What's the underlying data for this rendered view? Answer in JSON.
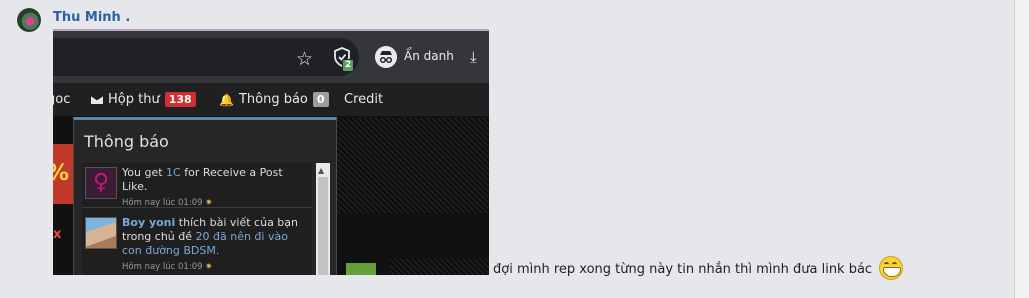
{
  "post": {
    "author": "Thu Minh .",
    "message": "đợi mình rep xong từng này tin nhắn thì mình đưa link bác"
  },
  "screenshot": {
    "browser": {
      "incognito_label": "Ẩn danh",
      "extension_badge": "2"
    },
    "site_nav": {
      "item_partial": "goc",
      "inbox_label": "Hộp thư",
      "inbox_count": "138",
      "alerts_label": "Thông báo",
      "alerts_count": "0",
      "credit_label": "Credit"
    },
    "promo": {
      "percent": "%",
      "x": "x"
    },
    "notifications": {
      "title": "Thông báo",
      "items": [
        {
          "pre": "You get ",
          "link": "1C",
          "post": " for Receive a Post Like.",
          "time": "Hôm nay lúc 01:09"
        },
        {
          "user": "Boy yoni",
          "pre": " thích bài viết của bạn trong chủ đề ",
          "link": "20 đã nên đi vào con đường BDSM.",
          "time": "Hôm nay lúc 01:09"
        }
      ]
    }
  },
  "icons": {
    "star": "star-icon",
    "shield": "shield-icon",
    "incognito": "incognito-icon",
    "download": "download-icon",
    "mail": "mail-icon",
    "bell": "bell-icon",
    "venus": "venus-icon",
    "grin": "grin-emoji-icon"
  },
  "colors": {
    "author": "#2d5fa8",
    "inbox_badge": "#d32f2f",
    "alerts_badge": "#9e9e9e",
    "popup_accent": "#5b88a8"
  }
}
